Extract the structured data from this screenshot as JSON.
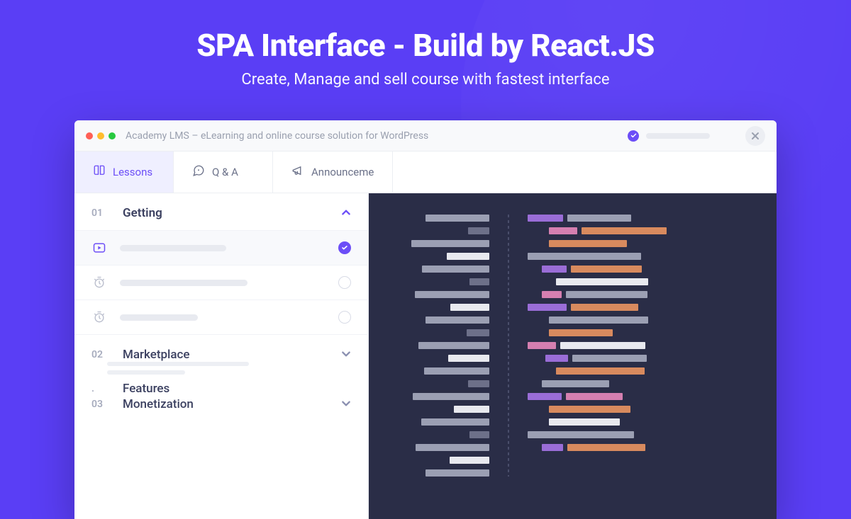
{
  "hero": {
    "title": "SPA Interface - Build by React.JS",
    "subtitle": "Create, Manage and sell course with fastest interface"
  },
  "window": {
    "title": "Academy LMS – eLearning and online course solution for WordPress"
  },
  "tabs": [
    {
      "label": "Lessons",
      "icon": "book-open-icon",
      "active": true
    },
    {
      "label": "Q & A",
      "icon": "chat-icon",
      "active": false
    },
    {
      "label": "Announceme",
      "icon": "megaphone-icon",
      "active": false
    }
  ],
  "sections": [
    {
      "num": "01",
      "title": "Getting",
      "expanded": true,
      "lessons": [
        {
          "icon": "play",
          "done": true,
          "active": true
        },
        {
          "icon": "timer",
          "done": false,
          "active": false
        },
        {
          "icon": "timer",
          "done": false,
          "active": false
        }
      ]
    },
    {
      "num": "02",
      "title": "Marketplace",
      "expanded": false
    },
    {
      "num": ".",
      "title": "Features",
      "expanded": false,
      "nohead": true
    },
    {
      "num": "03",
      "title": "Monetization",
      "expanded": false
    }
  ],
  "colors": {
    "accent": "#6c4ef7",
    "bg": "#5a3ef5"
  }
}
